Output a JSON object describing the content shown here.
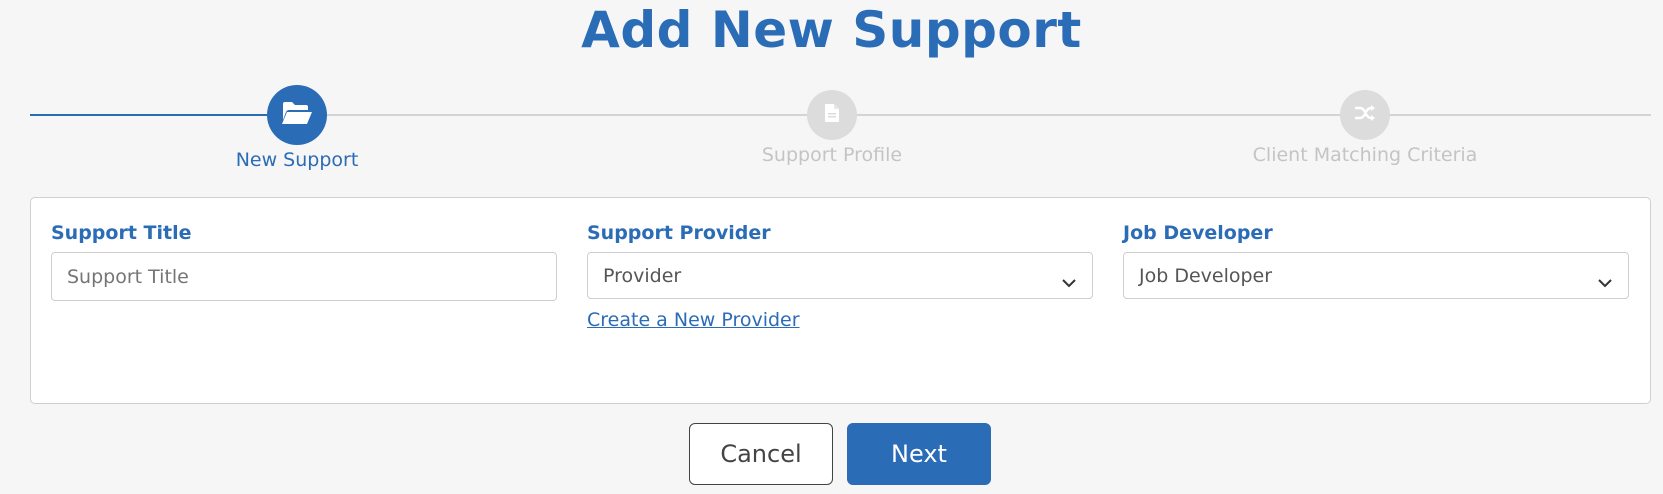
{
  "page": {
    "title": "Add New Support"
  },
  "stepper": {
    "steps": [
      {
        "label": "New Support",
        "icon": "folder-open-icon",
        "state": "active"
      },
      {
        "label": "Support Profile",
        "icon": "document-icon",
        "state": "inactive"
      },
      {
        "label": "Client Matching Criteria",
        "icon": "shuffle-icon",
        "state": "inactive"
      }
    ]
  },
  "form": {
    "support_title": {
      "label": "Support Title",
      "placeholder": "Support Title",
      "value": ""
    },
    "support_provider": {
      "label": "Support Provider",
      "selected": "Provider",
      "create_link": "Create a New Provider"
    },
    "job_developer": {
      "label": "Job Developer",
      "selected": "Job Developer"
    }
  },
  "actions": {
    "cancel_label": "Cancel",
    "next_label": "Next"
  },
  "colors": {
    "accent": "#2b6cb6",
    "inactive_step": "#dcdcdc",
    "inactive_text": "#c4c4c4",
    "background": "#f6f6f6"
  }
}
